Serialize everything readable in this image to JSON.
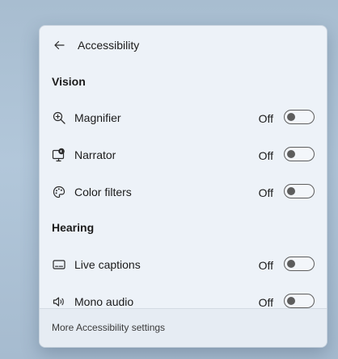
{
  "header": {
    "title": "Accessibility",
    "back_icon": "back-arrow-icon"
  },
  "sections": [
    {
      "title": "Vision",
      "items": [
        {
          "label": "Magnifier",
          "icon": "magnifier-icon",
          "state": "Off",
          "on": false
        },
        {
          "label": "Narrator",
          "icon": "narrator-icon",
          "state": "Off",
          "on": false
        },
        {
          "label": "Color filters",
          "icon": "color-filters-icon",
          "state": "Off",
          "on": false
        }
      ]
    },
    {
      "title": "Hearing",
      "items": [
        {
          "label": "Live captions",
          "icon": "live-captions-icon",
          "state": "Off",
          "on": false
        },
        {
          "label": "Mono audio",
          "icon": "mono-audio-icon",
          "state": "Off",
          "on": false
        }
      ]
    }
  ],
  "footer": {
    "link": "More Accessibility settings"
  },
  "colors": {
    "panel": "#edf2f8",
    "toggle_off_border": "#5d5d5d",
    "desktop": "#a9bfd3"
  }
}
